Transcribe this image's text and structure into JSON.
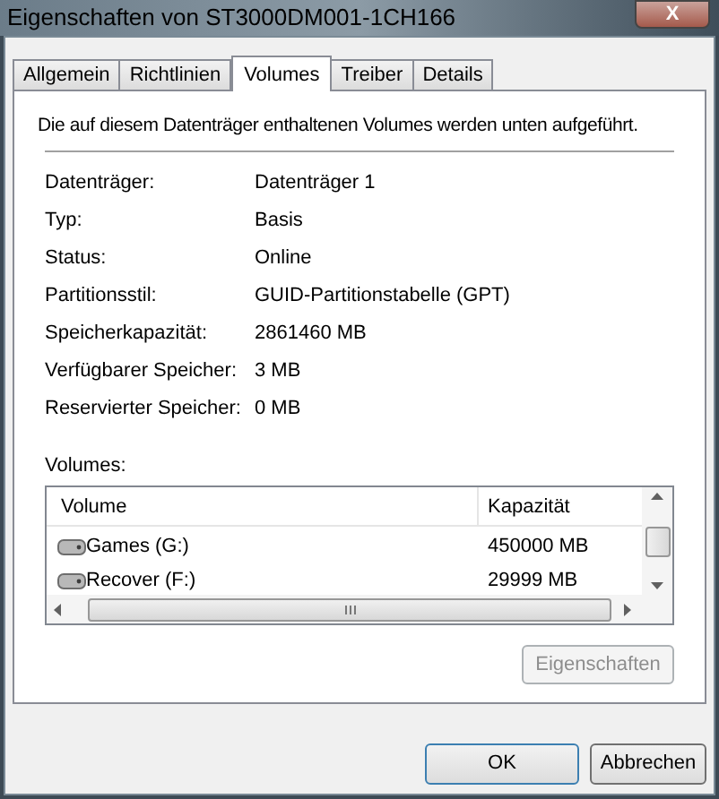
{
  "window": {
    "title": "Eigenschaften von ST3000DM001-1CH166",
    "close": "X"
  },
  "tabs": [
    {
      "label": "Allgemein",
      "selected": false
    },
    {
      "label": "Richtlinien",
      "selected": false
    },
    {
      "label": "Volumes",
      "selected": true
    },
    {
      "label": "Treiber",
      "selected": false
    },
    {
      "label": "Details",
      "selected": false
    }
  ],
  "description": "Die auf diesem Datenträger enthaltenen Volumes werden unten aufgeführt.",
  "properties": [
    {
      "label": "Datenträger:",
      "value": "Datenträger 1"
    },
    {
      "label": "Typ:",
      "value": "Basis"
    },
    {
      "label": "Status:",
      "value": "Online"
    },
    {
      "label": "Partitionsstil:",
      "value": "GUID-Partitionstabelle (GPT)"
    },
    {
      "label": "Speicherkapazität:",
      "value": "2861460 MB"
    },
    {
      "label": "Verfügbarer Speicher:",
      "value": "3 MB"
    },
    {
      "label": "Reservierter Speicher:",
      "value": "0 MB"
    }
  ],
  "volumes": {
    "label": "Volumes:",
    "columns": [
      "Volume",
      "Kapazität"
    ],
    "rows": [
      {
        "name": "Games (G:)",
        "capacity": "450000 MB"
      },
      {
        "name": "Recover (F:)",
        "capacity": "29999 MB"
      }
    ]
  },
  "properties_button": {
    "label": "Eigenschaften",
    "disabled": true
  },
  "buttons": [
    {
      "label": "OK"
    },
    {
      "label": "Abbrechen"
    }
  ]
}
